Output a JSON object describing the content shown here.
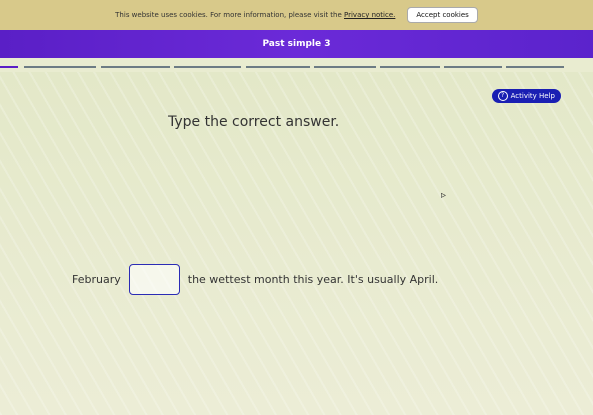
{
  "cookie": {
    "text": "This website uses cookies. For more information, please visit the",
    "privacy_link": "Privacy notice.",
    "accept_label": "Accept cookies"
  },
  "header": {
    "title": "Past simple 3"
  },
  "help": {
    "label": "Activity Help",
    "icon": "?"
  },
  "question": {
    "instruction": "Type the correct answer.",
    "before": "February",
    "after": "the wettest month this year. It's usually April."
  },
  "answer": {
    "value": ""
  },
  "colors": {
    "accent": "#5a1fc6",
    "help": "#1a1fb3"
  }
}
